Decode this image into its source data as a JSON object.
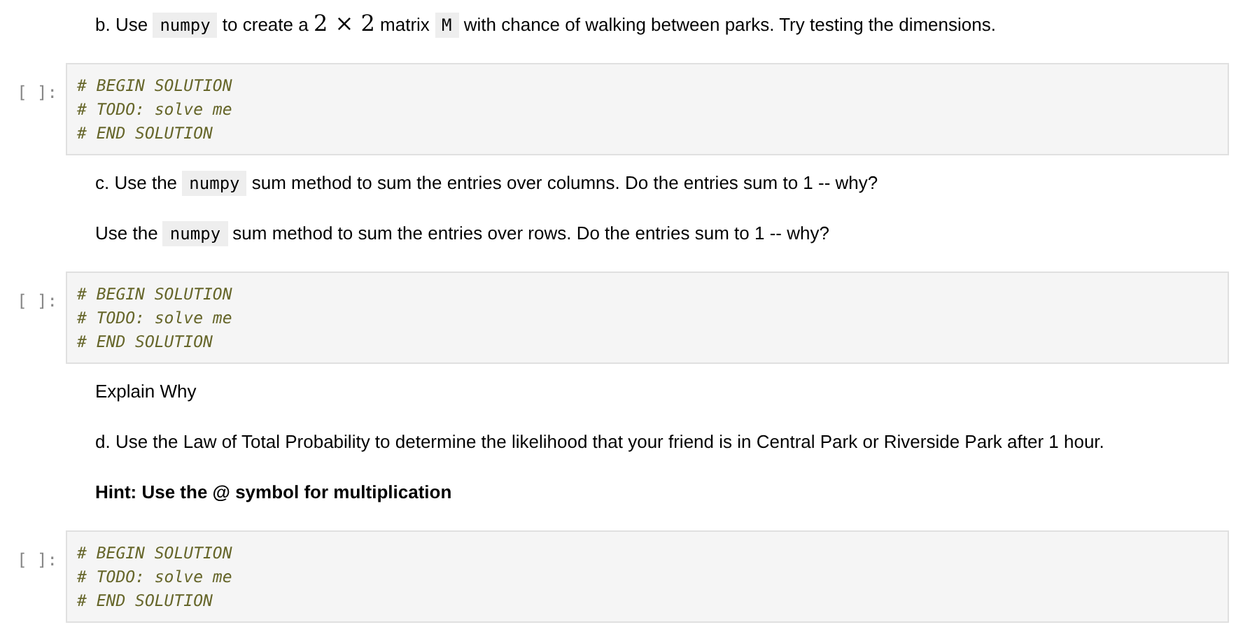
{
  "cells": [
    {
      "kind": "markdown",
      "paragraphs": [
        {
          "bold": false,
          "segments": [
            {
              "kind": "text",
              "text": "b. Use "
            },
            {
              "kind": "code",
              "text": "numpy"
            },
            {
              "kind": "text",
              "text": " to create a "
            },
            {
              "kind": "math",
              "text": "2 × 2"
            },
            {
              "kind": "text",
              "text": " matrix "
            },
            {
              "kind": "code",
              "text": "M"
            },
            {
              "kind": "text",
              "text": " with chance of walking between parks. Try testing the dimensions."
            }
          ]
        }
      ]
    },
    {
      "kind": "code",
      "prompt": "[ ]:",
      "lines": [
        "# BEGIN SOLUTION",
        "# TODO: solve me",
        "# END SOLUTION"
      ]
    },
    {
      "kind": "markdown",
      "paragraphs": [
        {
          "bold": false,
          "segments": [
            {
              "kind": "text",
              "text": "c. Use the "
            },
            {
              "kind": "code",
              "text": "numpy"
            },
            {
              "kind": "text",
              "text": " sum method to sum the entries over columns. Do the entries sum to 1 -- why?"
            }
          ]
        },
        {
          "bold": false,
          "segments": [
            {
              "kind": "text",
              "text": "Use the "
            },
            {
              "kind": "code",
              "text": "numpy"
            },
            {
              "kind": "text",
              "text": " sum method to sum the entries over rows. Do the entries sum to 1 -- why?"
            }
          ]
        }
      ]
    },
    {
      "kind": "code",
      "prompt": "[ ]:",
      "lines": [
        "# BEGIN SOLUTION",
        "# TODO: solve me",
        "# END SOLUTION"
      ]
    },
    {
      "kind": "markdown",
      "paragraphs": [
        {
          "bold": false,
          "segments": [
            {
              "kind": "text",
              "text": "Explain Why"
            }
          ]
        }
      ]
    },
    {
      "kind": "markdown",
      "paragraphs": [
        {
          "bold": false,
          "segments": [
            {
              "kind": "text",
              "text": "d. Use the Law of Total Probability to determine the likelihood that your friend is in Central Park or Riverside Park after 1 hour."
            }
          ]
        },
        {
          "bold": true,
          "segments": [
            {
              "kind": "text",
              "text": "Hint: Use the @ symbol for multiplication"
            }
          ]
        }
      ]
    },
    {
      "kind": "code",
      "prompt": "[ ]:",
      "lines": [
        "# BEGIN SOLUTION",
        "# TODO: solve me",
        "# END SOLUTION"
      ]
    }
  ]
}
